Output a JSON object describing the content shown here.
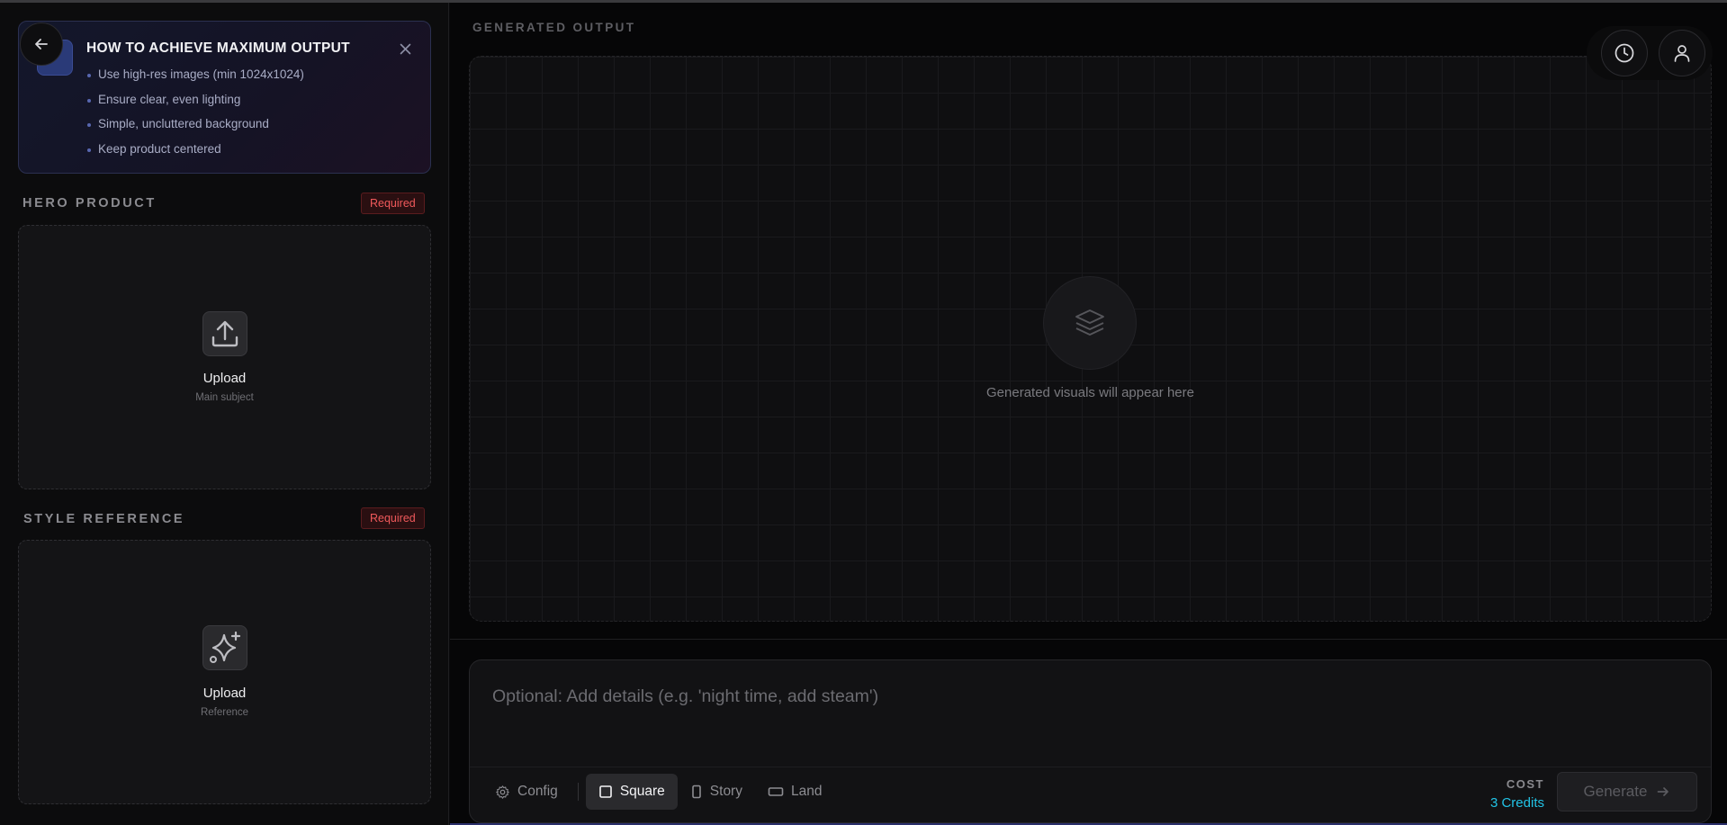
{
  "tips": {
    "title": "HOW TO ACHIEVE MAXIMUM OUTPUT",
    "items": [
      "Use high-res images (min 1024x1024)",
      "Ensure clear, even lighting",
      "Simple, uncluttered background",
      "Keep product centered"
    ]
  },
  "hero": {
    "label": "HERO PRODUCT",
    "required": "Required",
    "upload_label": "Upload",
    "upload_sub": "Main subject"
  },
  "style": {
    "label": "STYLE REFERENCE",
    "required": "Required",
    "upload_label": "Upload",
    "upload_sub": "Reference"
  },
  "output": {
    "label": "GENERATED OUTPUT",
    "empty_text": "Generated visuals will appear here"
  },
  "composer": {
    "placeholder": "Optional: Add details (e.g. 'night time, add steam')",
    "config_label": "Config",
    "ratios": [
      {
        "label": "Square",
        "active": true
      },
      {
        "label": "Story",
        "active": false
      },
      {
        "label": "Land",
        "active": false
      }
    ],
    "cost_label": "COST",
    "cost_value": "3 Credits",
    "generate_label": "Generate"
  },
  "colors": {
    "accent_cyan": "#22c3e6",
    "required_red": "#f0595b"
  }
}
